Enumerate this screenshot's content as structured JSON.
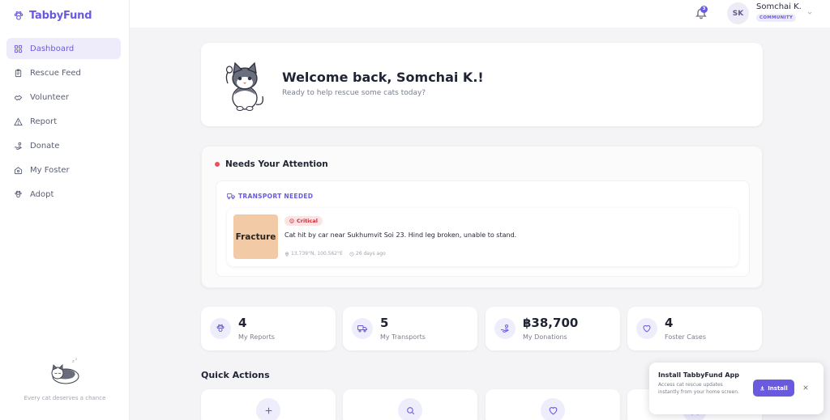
{
  "app": {
    "name": "TabbyFund",
    "brand_color": "#6a5ae0"
  },
  "sidebar": {
    "items": [
      {
        "label": "Dashboard",
        "icon": "grid-icon",
        "active": true
      },
      {
        "label": "Rescue Feed",
        "icon": "clipboard-icon",
        "active": false
      },
      {
        "label": "Volunteer",
        "icon": "handshake-icon",
        "active": false
      },
      {
        "label": "Report",
        "icon": "warning-triangle-icon",
        "active": false
      },
      {
        "label": "Donate",
        "icon": "hand-coin-icon",
        "active": false
      },
      {
        "label": "My Foster",
        "icon": "home-icon",
        "active": false
      },
      {
        "label": "Adopt",
        "icon": "paw-icon",
        "active": false
      }
    ],
    "footer_tagline": "Every cat deserves a chance"
  },
  "header": {
    "notification_count": "3",
    "user": {
      "initials": "SK",
      "name": "Somchai K.",
      "role": "COMMUNITY"
    }
  },
  "welcome": {
    "title": "Welcome back, Somchai K.!",
    "subtitle": "Ready to help rescue some cats today?"
  },
  "attention": {
    "title": "Needs Your Attention",
    "section_label": "TRANSPORT NEEDED",
    "case": {
      "thumb_label": "Fracture",
      "severity": "Critical",
      "description": "Cat hit by car near Sukhumvit Soi 23. Hind leg broken, unable to stand.",
      "location": "13.739°N, 100.562°E",
      "age": "26 days ago"
    }
  },
  "stats": [
    {
      "value": "4",
      "label": "My Reports",
      "icon": "paw-icon"
    },
    {
      "value": "5",
      "label": "My Transports",
      "icon": "truck-icon"
    },
    {
      "value": "฿38,700",
      "label": "My Donations",
      "icon": "hand-coin-icon"
    },
    {
      "value": "4",
      "label": "Foster Cases",
      "icon": "heart-icon"
    }
  ],
  "quick_actions": {
    "title": "Quick Actions",
    "items": [
      {
        "icon": "plus-icon"
      },
      {
        "icon": "search-icon"
      },
      {
        "icon": "heart-icon"
      },
      {
        "icon": "truck-icon"
      }
    ]
  },
  "install_banner": {
    "title": "Install TabbyFund App",
    "description": "Access cat rescue updates instantly from your home screen.",
    "button_label": "Install"
  },
  "colors": {
    "critical": "#c62f3b",
    "attention_dot": "#ef4f5c",
    "thumb_bg": "#f3caa6"
  }
}
